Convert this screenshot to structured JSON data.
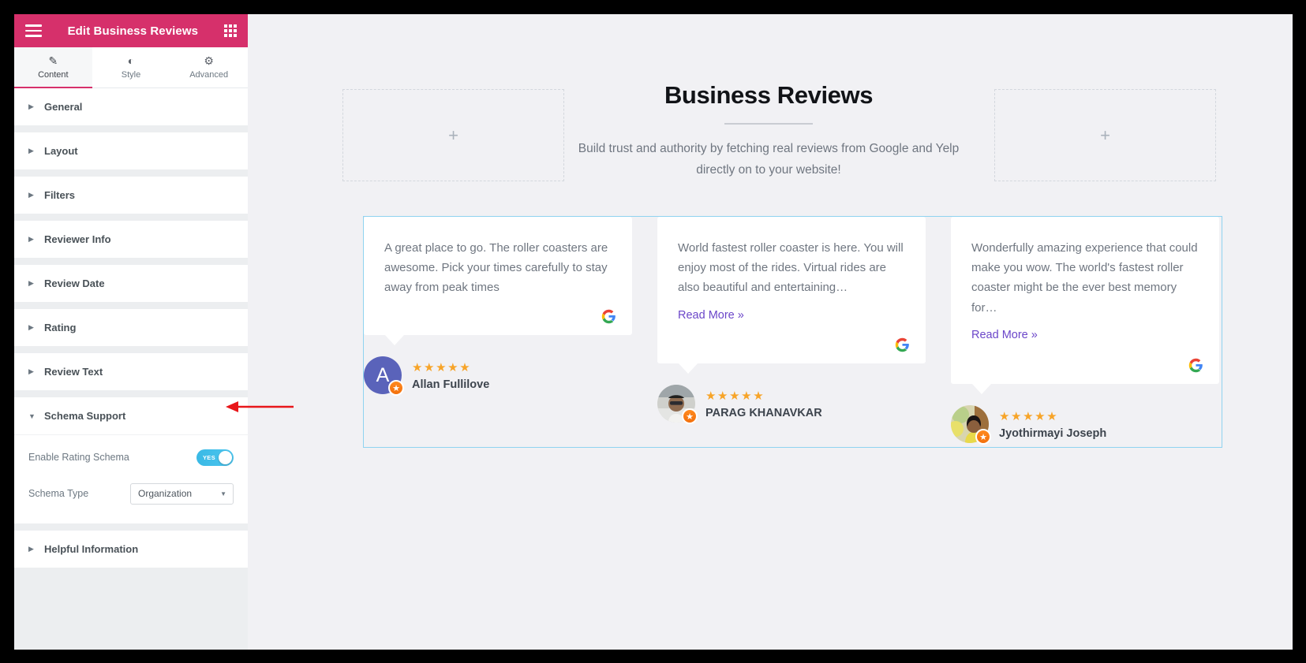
{
  "panel": {
    "title": "Edit Business Reviews",
    "menu_icon": "hamburger-icon",
    "grid_icon": "grid-apps-icon",
    "tabs": [
      {
        "label": "Content",
        "icon": "pencil-icon",
        "active": true
      },
      {
        "label": "Style",
        "icon": "contrast-circle-icon",
        "active": false
      },
      {
        "label": "Advanced",
        "icon": "gear-icon",
        "active": false
      }
    ],
    "sections": [
      {
        "label": "General",
        "expanded": false
      },
      {
        "label": "Layout",
        "expanded": false
      },
      {
        "label": "Filters",
        "expanded": false
      },
      {
        "label": "Reviewer Info",
        "expanded": false
      },
      {
        "label": "Review Date",
        "expanded": false
      },
      {
        "label": "Rating",
        "expanded": false
      },
      {
        "label": "Review Text",
        "expanded": false
      },
      {
        "label": "Schema Support",
        "expanded": true
      },
      {
        "label": "Helpful Information",
        "expanded": false
      }
    ],
    "schema": {
      "enable_label": "Enable Rating Schema",
      "enable_value": "YES",
      "type_label": "Schema Type",
      "type_value": "Organization",
      "toggle_color": "#4ec6ef"
    },
    "collapse_icon": "chevron-left-icon",
    "header_color": "#d6306b",
    "active_tab_accent": "#d6306b"
  },
  "canvas": {
    "placeholder_left": "+",
    "placeholder_right": "+",
    "hero": {
      "title": "Business Reviews",
      "subtitle": "Build trust and authority by fetching real reviews from Google and Yelp directly on to your website!"
    },
    "selection_border_color": "#8fd3f0",
    "reviews": [
      {
        "text": "A great place to go. The roller coasters are awesome. Pick your times carefully to stay away from peak times",
        "read_more": "",
        "source_icon": "google-g-icon",
        "stars": "★★★★★",
        "rating": 5,
        "name": "Allan Fullilove",
        "avatar_type": "initial",
        "avatar_initial": "A",
        "avatar_color": "#5a63ba",
        "badge_icon": "star-badge-icon"
      },
      {
        "text": "World fastest roller coaster is here. You will enjoy most of the rides. Virtual rides are also beautiful and entertaining…",
        "read_more": "Read More »",
        "source_icon": "google-g-icon",
        "stars": "★★★★★",
        "rating": 5,
        "name": "PARAG KHANAVKAR",
        "avatar_type": "photo",
        "avatar_initial": "",
        "avatar_color": "#b9b2a6",
        "badge_icon": "star-badge-icon"
      },
      {
        "text": "Wonderfully amazing experience that could make you wow. The world's fastest roller coaster might be the ever best memory for…",
        "read_more": "Read More »",
        "source_icon": "google-g-icon",
        "stars": "★★★★★",
        "rating": 5,
        "name": "Jyothirmayi Joseph",
        "avatar_type": "photo",
        "avatar_initial": "",
        "avatar_color": "#c7a05a",
        "badge_icon": "star-badge-icon"
      }
    ]
  },
  "annotation": {
    "arrow_color": "#e8161a",
    "points_to": "Enable Rating Schema"
  }
}
